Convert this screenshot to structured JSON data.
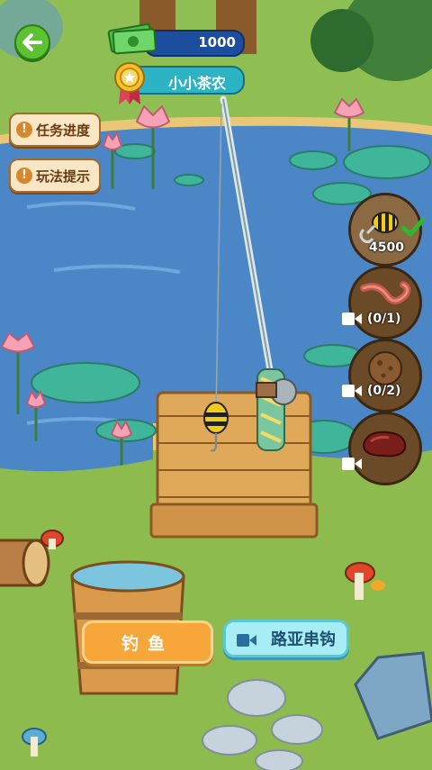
{
  "header": {
    "money": "1000",
    "player_title": "小小茶农"
  },
  "side_menu": {
    "task_progress": "任务进度",
    "gameplay_tips": "玩法提示"
  },
  "baits": {
    "lure": {
      "count": "4500",
      "icon": "bee-lure-icon",
      "selected": true
    },
    "worm": {
      "count": "(0/1)",
      "icon": "worm-icon"
    },
    "dough": {
      "count": "(0/2)",
      "icon": "dough-ball-icon"
    },
    "meat": {
      "count": "",
      "icon": "meat-icon"
    }
  },
  "actions": {
    "fish_label": "钓鱼",
    "lure_string_label": "路亚串钩"
  },
  "colors": {
    "pond": "#4b86c7",
    "grass": "#8dbb4e",
    "fish_button": "#f7a739",
    "lure_button": "#a8ecf4"
  }
}
